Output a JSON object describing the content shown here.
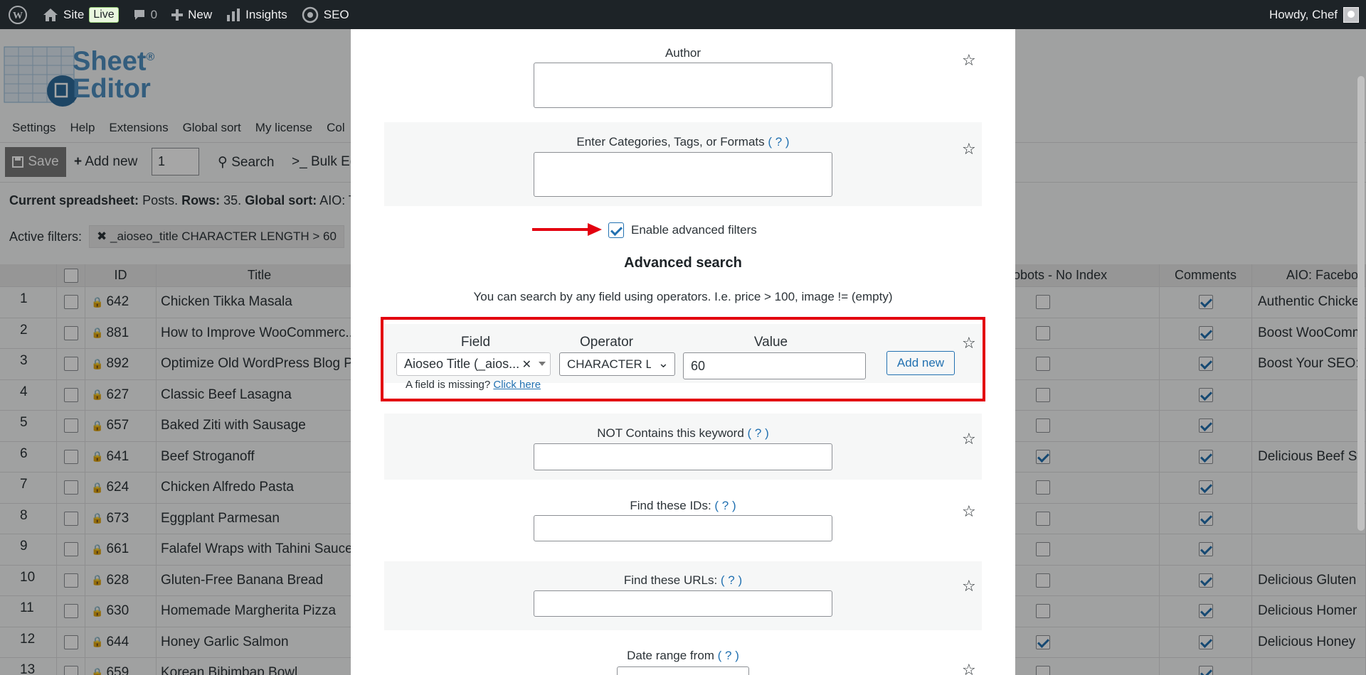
{
  "adminbar": {
    "site": "Site",
    "live": "Live",
    "comments_count": "0",
    "new": "New",
    "insights": "Insights",
    "seo": "SEO",
    "howdy": "Howdy, Chef"
  },
  "logo": {
    "line1": "Sheet",
    "line2": "Editor",
    "reg": "®"
  },
  "menu": [
    "Settings",
    "Help",
    "Extensions",
    "Global sort",
    "My license",
    "Col"
  ],
  "toolbar": {
    "save": "Save",
    "add_new": "Add new",
    "count": "1",
    "search": "Search",
    "bulk_edit": ">_ Bulk Ed"
  },
  "current": {
    "label1": "Current spreadsheet:",
    "val1": "Posts.",
    "label2": "Rows:",
    "val2": "35.",
    "label3": "Global sort:",
    "val3": "AIO: Tit"
  },
  "active_filters": {
    "label": "Active filters:",
    "chip": "_aioseo_title CHARACTER LENGTH > 60"
  },
  "grid": {
    "headers": {
      "id": "ID",
      "title": "Title",
      "robots": "obots - No Index",
      "comments": "Comments",
      "aio_fb": "AIO: Facebo"
    },
    "rows": [
      {
        "n": "1",
        "id": "642",
        "title": "Chicken Tikka Masala",
        "robots": false,
        "comments": true,
        "fb": "Authentic Chicke"
      },
      {
        "n": "2",
        "id": "881",
        "title": "How to Improve WooCommerc...",
        "robots": false,
        "comments": true,
        "fb": "Boost WooComm"
      },
      {
        "n": "3",
        "id": "892",
        "title": "Optimize Old WordPress Blog P...",
        "robots": false,
        "comments": true,
        "fb": "Boost Your SEO:"
      },
      {
        "n": "4",
        "id": "627",
        "title": "Classic Beef Lasagna",
        "robots": false,
        "comments": true,
        "fb": ""
      },
      {
        "n": "5",
        "id": "657",
        "title": "Baked Ziti with Sausage",
        "robots": false,
        "comments": true,
        "fb": ""
      },
      {
        "n": "6",
        "id": "641",
        "title": "Beef Stroganoff",
        "robots": true,
        "comments": true,
        "fb": "Delicious Beef St"
      },
      {
        "n": "7",
        "id": "624",
        "title": "Chicken Alfredo Pasta",
        "robots": false,
        "comments": true,
        "fb": ""
      },
      {
        "n": "8",
        "id": "673",
        "title": "Eggplant Parmesan",
        "robots": false,
        "comments": true,
        "fb": ""
      },
      {
        "n": "9",
        "id": "661",
        "title": "Falafel Wraps with Tahini Sauce",
        "robots": false,
        "comments": true,
        "fb": ""
      },
      {
        "n": "10",
        "id": "628",
        "title": "Gluten-Free Banana Bread",
        "robots": false,
        "comments": true,
        "fb": "Delicious Gluten"
      },
      {
        "n": "11",
        "id": "630",
        "title": "Homemade Margherita Pizza",
        "robots": false,
        "comments": true,
        "fb": "Delicious Homer"
      },
      {
        "n": "12",
        "id": "644",
        "title": "Honey Garlic Salmon",
        "robots": true,
        "comments": true,
        "fb": "Delicious Honey"
      },
      {
        "n": "13",
        "id": "659",
        "title": "Korean Bibimbap Bowl",
        "robots": false,
        "comments": true,
        "fb": ""
      }
    ]
  },
  "modal": {
    "author_label": "Author",
    "cats_label": "Enter Categories, Tags, or Formats",
    "help_link": "( ? )",
    "enable_adv": "Enable advanced filters",
    "adv_title": "Advanced search",
    "adv_desc": "You can search by any field using operators. I.e. price > 100, image != (empty)",
    "field_h": "Field",
    "operator_h": "Operator",
    "value_h": "Value",
    "field_val": "Aioseo Title (_aios...",
    "operator_val": "CHARACTER LE",
    "value_val": "60",
    "add_new": "Add new",
    "missing": "A field is missing?",
    "click_here": "Click here",
    "not_contains": "NOT Contains this keyword",
    "find_ids": "Find these IDs:",
    "find_urls": "Find these URLs:",
    "date_from": "Date range from"
  },
  "colors": {
    "admin_bar": "#1d2327",
    "accent": "#2271b1",
    "highlight": "#e3000f"
  }
}
